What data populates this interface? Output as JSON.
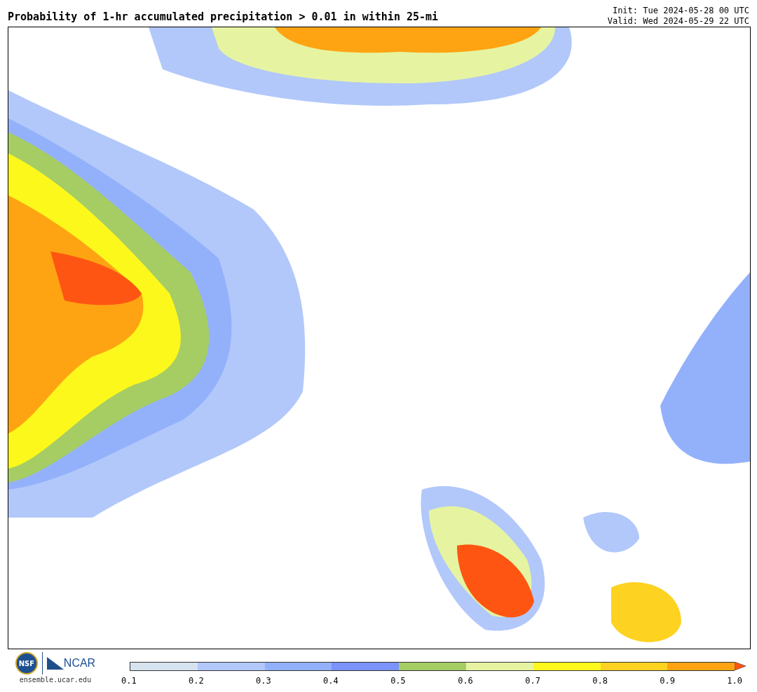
{
  "title": "Probability of 1-hr accumulated precipitation > 0.01 in within 25-mi",
  "init": "Init: Tue 2024-05-28 00 UTC",
  "valid": "Valid: Wed 2024-05-29 22 UTC",
  "logo": {
    "seal_text": "NSF",
    "wordmark": "NCAR",
    "url": "ensemble.ucar.edu"
  },
  "colorbar": {
    "bins": [
      {
        "color": "#d6e2ee"
      },
      {
        "color": "#b2c8fa"
      },
      {
        "color": "#93b1fb"
      },
      {
        "color": "#7b93fb"
      },
      {
        "color": "#a5cd64"
      },
      {
        "color": "#e6f4a2"
      },
      {
        "color": "#fdf81b"
      },
      {
        "color": "#fdd220"
      },
      {
        "color": "#fea412"
      },
      {
        "color": "#fe5612",
        "kind": "arrow"
      }
    ],
    "ticks": [
      "0.1",
      "0.2",
      "0.3",
      "0.4",
      "0.5",
      "0.6",
      "0.7",
      "0.8",
      "0.9",
      "1.0"
    ]
  }
}
